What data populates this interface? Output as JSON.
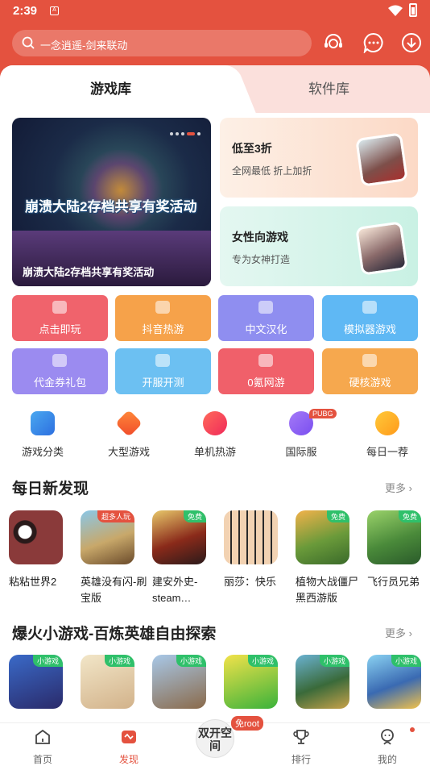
{
  "status": {
    "time": "2:39",
    "sim": "A"
  },
  "search": {
    "placeholder": "一念逍遥-剑来联动"
  },
  "tabs": [
    {
      "label": "游戏库"
    },
    {
      "label": "软件库"
    }
  ],
  "banner": {
    "big_text": "崩溃大陆2存档共享有奖活动",
    "caption": "崩溃大陆2存档共享有奖活动"
  },
  "promos": [
    {
      "title": "低至3折",
      "subtitle": "全网最低 折上加折"
    },
    {
      "title": "女性向游戏",
      "subtitle": "专为女神打造"
    }
  ],
  "categories": [
    {
      "label": "点击即玩",
      "color": "#f0636c"
    },
    {
      "label": "抖音热游",
      "color": "#f6a24a"
    },
    {
      "label": "中文汉化",
      "color": "#8f8ef0"
    },
    {
      "label": "模拟器游戏",
      "color": "#5fb8f4"
    },
    {
      "label": "代金券礼包",
      "color": "#9b8bf0"
    },
    {
      "label": "开服开测",
      "color": "#6cc0f2"
    },
    {
      "label": "0氪网游",
      "color": "#f0606a"
    },
    {
      "label": "硬核游戏",
      "color": "#f6a84e"
    }
  ],
  "quick_nav": [
    {
      "label": "游戏分类",
      "icon": "category-icon"
    },
    {
      "label": "大型游戏",
      "icon": "large-game-icon"
    },
    {
      "label": "单机热游",
      "icon": "single-player-icon"
    },
    {
      "label": "国际服",
      "icon": "international-icon",
      "badge": "PUBG"
    },
    {
      "label": "每日一荐",
      "icon": "daily-pick-icon"
    }
  ],
  "section1": {
    "title": "每日新发现",
    "more": "更多",
    "games": [
      {
        "name": "粘粘世界2",
        "badge": ""
      },
      {
        "name": "英雄没有闪-刷宝版",
        "badge": "超多人玩"
      },
      {
        "name": "建安外史-steam…",
        "badge": "免费"
      },
      {
        "name": "丽莎：快乐",
        "badge": ""
      },
      {
        "name": "植物大战僵尸黑西游版",
        "badge": "免费"
      },
      {
        "name": "飞行员兄弟",
        "badge": "免费"
      }
    ]
  },
  "section2": {
    "title": "爆火小游戏-百炼英雄自由探索",
    "more": "更多",
    "badge": "小游戏"
  },
  "bottom_nav": [
    {
      "label": "首页"
    },
    {
      "label": "发现"
    },
    {
      "label": "双开空间"
    },
    {
      "label": "排行"
    },
    {
      "label": "我的"
    }
  ],
  "center_badge": "免root",
  "colors": {
    "brand": "#e4523f"
  }
}
